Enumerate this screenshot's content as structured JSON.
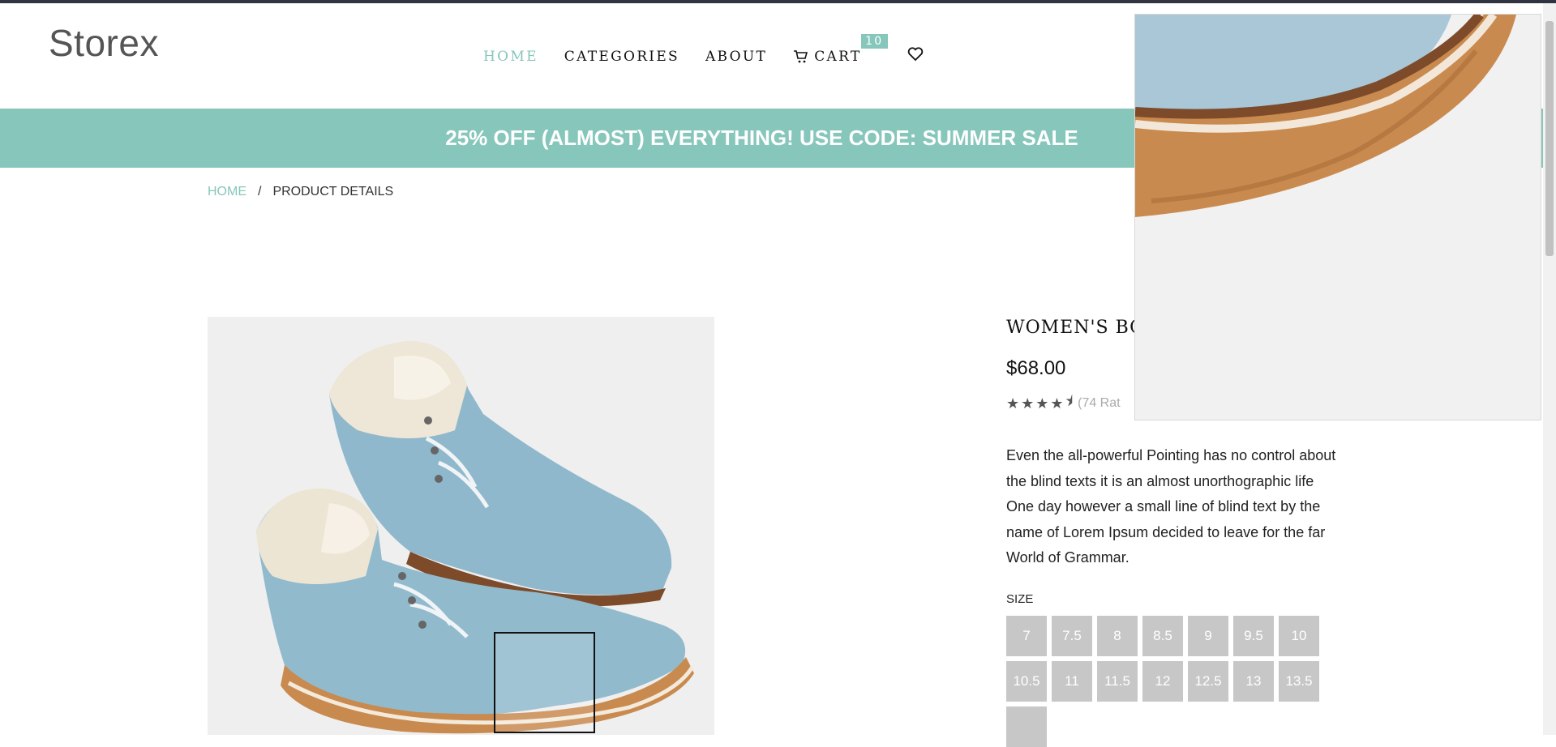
{
  "brand": "Storex",
  "nav": {
    "home": "HOME",
    "categories": "CATEGORIES",
    "about": "ABOUT",
    "cart": "CART",
    "cart_count": "10"
  },
  "promo": "25% OFF (ALMOST) EVERYTHING! USE CODE: SUMMER SALE",
  "breadcrumb": {
    "home": "HOME",
    "separator": "/",
    "current": "PRODUCT DETAILS"
  },
  "product": {
    "title_visible": "WOMEN'S BOO",
    "price": "$68.00",
    "rating_value": 4.5,
    "rating_text_visible": "(74 Rat",
    "description": "Even the all-powerful Pointing has no control about the blind texts it is an almost unorthographic life One day however a small line of blind text by the name of Lorem Ipsum decided to leave for the far World of Grammar.",
    "size_label": "SIZE",
    "sizes": [
      "7",
      "7.5",
      "8",
      "8.5",
      "9",
      "9.5",
      "10",
      "10.5",
      "11",
      "11.5",
      "12",
      "12.5",
      "13",
      "13.5"
    ]
  },
  "colors": {
    "accent": "#86c6bb",
    "size_button": "#c7c7c7",
    "boot_blue": "#8fb8cc"
  }
}
